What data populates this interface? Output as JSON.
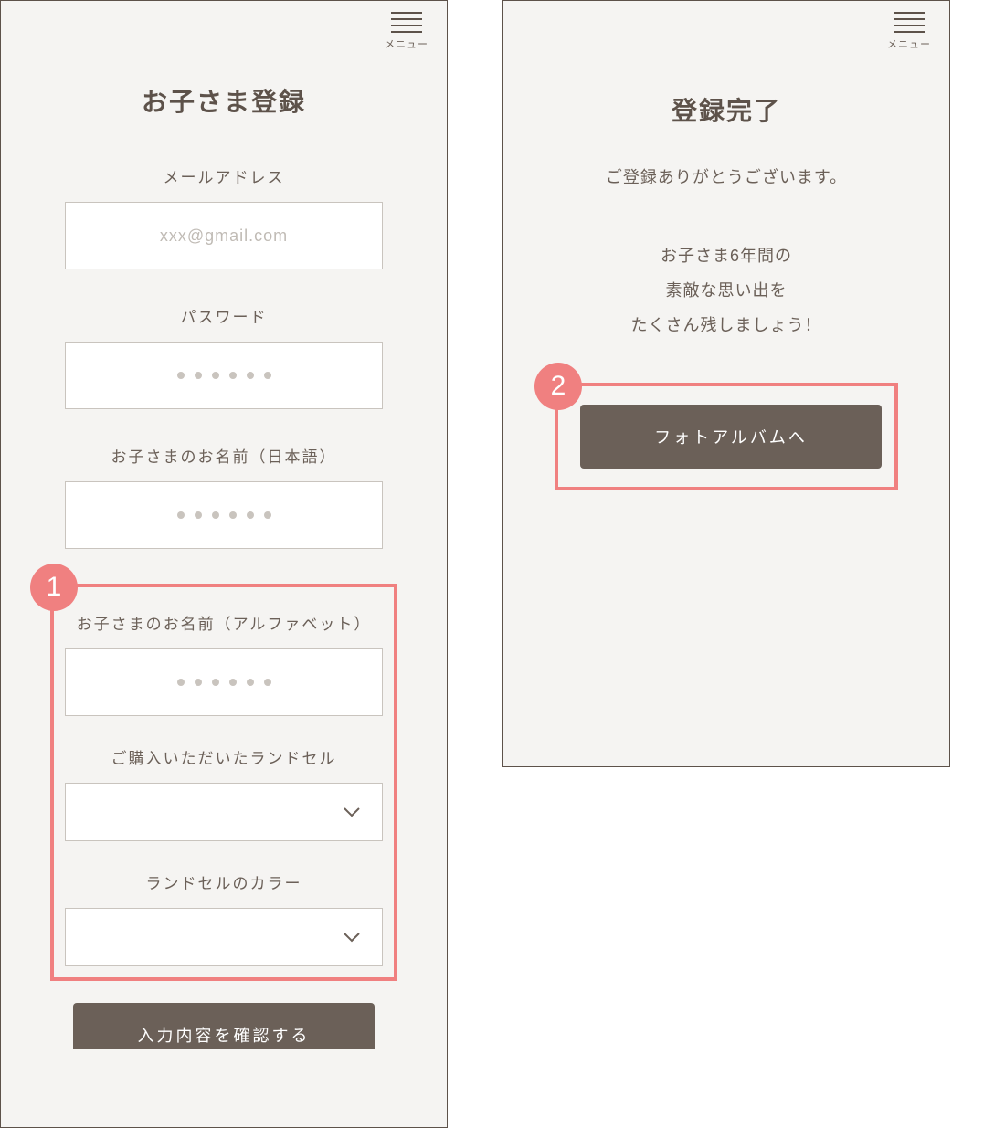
{
  "left": {
    "menu_label": "メニュー",
    "title": "お子さま登録",
    "fields": {
      "email_label": "メールアドレス",
      "email_placeholder": "xxx@gmail.com",
      "password_label": "パスワード",
      "name_jp_label": "お子さまのお名前（日本語）",
      "name_en_label": "お子さまのお名前（アルファベット）",
      "product_label": "ご購入いただいたランドセル",
      "color_label": "ランドセルのカラー"
    },
    "badge_1": "1",
    "submit_label": "入力内容を確認する"
  },
  "right": {
    "menu_label": "メニュー",
    "title": "登録完了",
    "thanks": "ご登録ありがとうございます。",
    "promo_line1": "お子さま6年間の",
    "promo_line2": "素敵な思い出を",
    "promo_line3": "たくさん残しましょう！",
    "badge_2": "2",
    "cta_label": "フォトアルバムへ"
  }
}
